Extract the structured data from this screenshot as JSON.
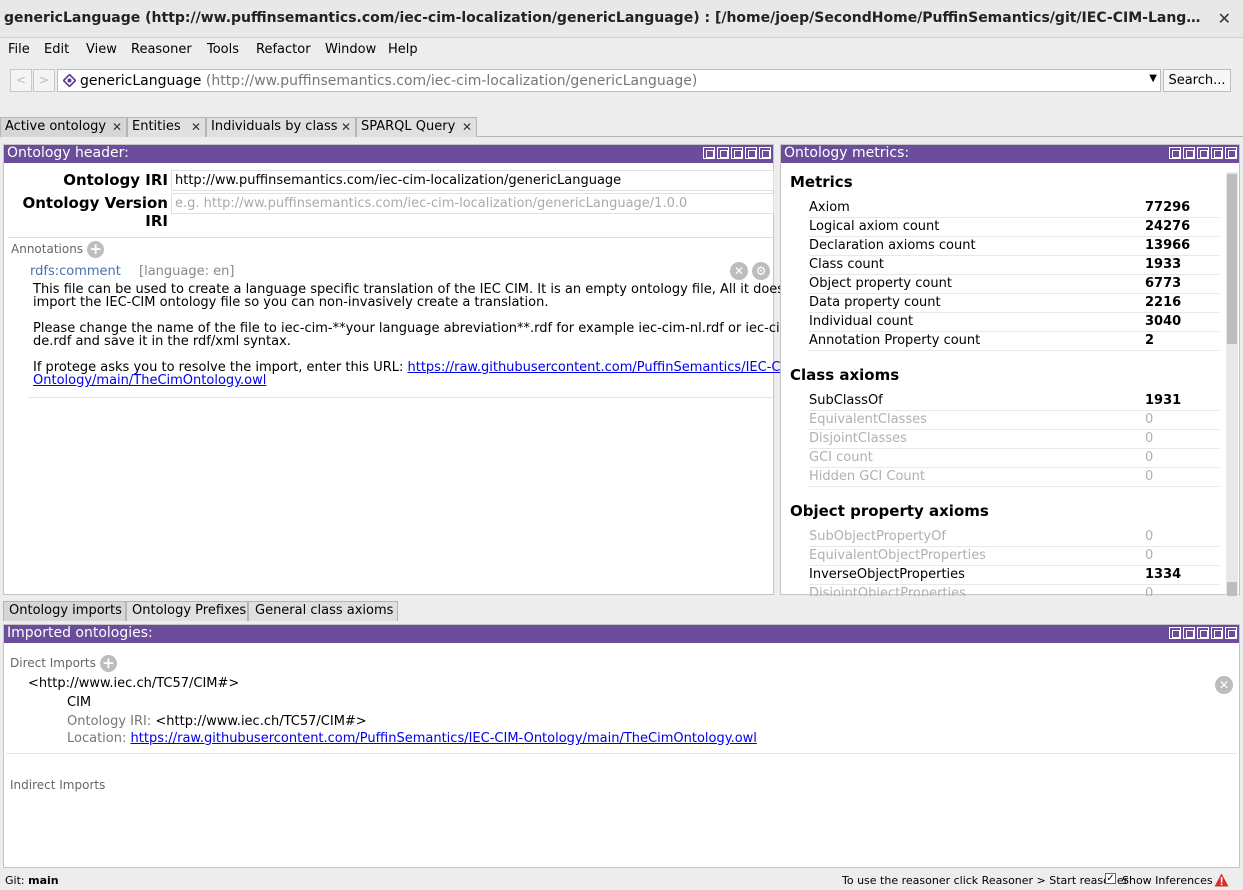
{
  "window": {
    "title": "genericLanguage (http://ww.puffinsemantics.com/iec-cim-localization/genericLanguage) : [/home/joep/SecondHome/PuffinSemantics/git/IEC-CIM-Language-Localization/iec-cim-g..."
  },
  "menu": [
    "File",
    "Edit",
    "View",
    "Reasoner",
    "Tools",
    "Refactor",
    "Window",
    "Help"
  ],
  "nav": {
    "back": "<",
    "forward": ">",
    "entity_name": "genericLanguage",
    "entity_iri": "(http://ww.puffinsemantics.com/iec-cim-localization/genericLanguage)",
    "search_label": "Search..."
  },
  "tabs": [
    "Active ontology",
    "Entities",
    "Individuals by class",
    "SPARQL Query"
  ],
  "header_view": {
    "title": "Ontology header:",
    "iri_label": "Ontology IRI",
    "iri_value": "http://ww.puffinsemantics.com/iec-cim-localization/genericLanguage",
    "version_label": "Ontology Version IRI",
    "version_placeholder": "e.g. http://ww.puffinsemantics.com/iec-cim-localization/genericLanguage/1.0.0",
    "annotations_label": "Annotations",
    "annotation": {
      "property": "rdfs:comment",
      "language": "[language: en]",
      "lines": [
        "This file can be used to create a language specific translation of the IEC CIM. It is an empty ontology file, All it does is",
        "import the IEC-CIM ontology file so you can non-invasively create a translation.",
        "",
        "Please change the name of the file to iec-cim-**your language abreviation**.rdf  for example iec-cim-nl.rdf or iec-cim-",
        "de.rdf and save it in the rdf/xml syntax.",
        "",
        "If protege asks you to resolve the import, enter this URL: "
      ],
      "url_part1": "https://raw.githubusercontent.com/PuffinSemantics/IEC-CIM-",
      "url_part2": "Ontology/main/TheCimOntology.owl"
    }
  },
  "metrics_view": {
    "title": "Ontology metrics:",
    "sections": [
      {
        "name": "Metrics",
        "rows": [
          {
            "label": "Axiom",
            "value": "77296",
            "dim": false
          },
          {
            "label": "Logical axiom count",
            "value": "24276",
            "dim": false
          },
          {
            "label": "Declaration axioms count",
            "value": "13966",
            "dim": false
          },
          {
            "label": "Class count",
            "value": "1933",
            "dim": false
          },
          {
            "label": "Object property count",
            "value": "6773",
            "dim": false
          },
          {
            "label": "Data property count",
            "value": "2216",
            "dim": false
          },
          {
            "label": "Individual count",
            "value": "3040",
            "dim": false
          },
          {
            "label": "Annotation Property count",
            "value": "2",
            "dim": false
          }
        ]
      },
      {
        "name": "Class axioms",
        "rows": [
          {
            "label": "SubClassOf",
            "value": "1931",
            "dim": false
          },
          {
            "label": "EquivalentClasses",
            "value": "0",
            "dim": true
          },
          {
            "label": "DisjointClasses",
            "value": "0",
            "dim": true
          },
          {
            "label": "GCI count",
            "value": "0",
            "dim": true
          },
          {
            "label": "Hidden GCI Count",
            "value": "0",
            "dim": true
          }
        ]
      },
      {
        "name": "Object property axioms",
        "rows": [
          {
            "label": "SubObjectPropertyOf",
            "value": "0",
            "dim": true
          },
          {
            "label": "EquivalentObjectProperties",
            "value": "0",
            "dim": true
          },
          {
            "label": "InverseObjectProperties",
            "value": "1334",
            "dim": false
          },
          {
            "label": "DisjointObjectProperties",
            "value": "0",
            "dim": true
          }
        ]
      }
    ]
  },
  "bottom_tabs": [
    "Ontology imports",
    "Ontology Prefixes",
    "General class axioms"
  ],
  "imports_view": {
    "title": "Imported ontologies:",
    "direct_label": "Direct Imports",
    "import_iri": "<http://www.iec.ch/TC57/CIM#>",
    "import_name": "CIM",
    "ontology_iri_label": "Ontology IRI:",
    "ontology_iri_value": "<http://www.iec.ch/TC57/CIM#>",
    "location_label": "Location:",
    "location_value": "https://raw.githubusercontent.com/PuffinSemantics/IEC-CIM-Ontology/main/TheCimOntology.owl",
    "indirect_label": "Indirect Imports"
  },
  "status": {
    "git_label": "Git:",
    "git_branch": "main",
    "reasoner_hint": "To use the reasoner click Reasoner > Start reasoner",
    "show_inferences": "Show Inferences",
    "show_inferences_checked": true
  }
}
